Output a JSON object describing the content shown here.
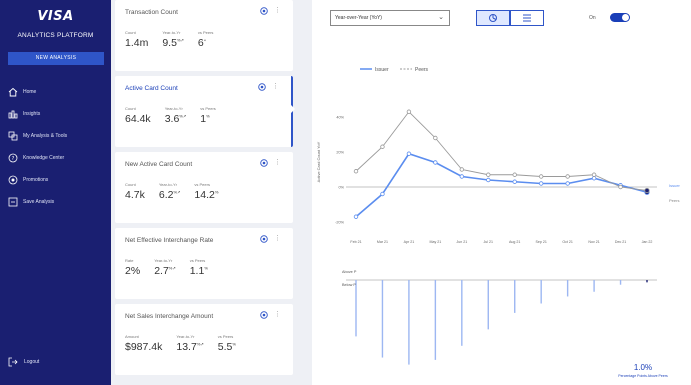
{
  "sidebar": {
    "brand": "VISA",
    "subtitle": "ANALYTICS PLATFORM",
    "new_button": "NEW ANALYSIS",
    "items": [
      {
        "label": "Home"
      },
      {
        "label": "Insights"
      },
      {
        "label": "My Analysis & Tools"
      },
      {
        "label": "Knowledge Center"
      },
      {
        "label": "Promotions"
      },
      {
        "label": "Save Analysis"
      }
    ],
    "signout": "Logout"
  },
  "cards": [
    {
      "title": "Transaction Count",
      "metrics": [
        {
          "label": "Count",
          "value": "1.4m",
          "trend": ""
        },
        {
          "label": "Year-to-Yr",
          "value": "9.5",
          "trend": "%↗"
        },
        {
          "label": "vs Peers",
          "value": "6",
          "trend": "×"
        }
      ]
    },
    {
      "title": "Active Card Count",
      "metrics": [
        {
          "label": "Count",
          "value": "64.4k",
          "trend": ""
        },
        {
          "label": "Year-to-Yr",
          "value": "3.6",
          "trend": "%↗"
        },
        {
          "label": "vs Peers",
          "value": "1",
          "trend": "%"
        }
      ]
    },
    {
      "title": "New Active Card Count",
      "metrics": [
        {
          "label": "Count",
          "value": "4.7k",
          "trend": ""
        },
        {
          "label": "Year-to-Yr",
          "value": "6.2",
          "trend": "%↗"
        },
        {
          "label": "vs Peers",
          "value": "14.2",
          "trend": "%"
        }
      ]
    },
    {
      "title": "Net Effective Interchange Rate",
      "metrics": [
        {
          "label": "Rate",
          "value": "2%",
          "trend": ""
        },
        {
          "label": "Year-to-Yr",
          "value": "2.7",
          "trend": "%↗"
        },
        {
          "label": "vs Peers",
          "value": "1.1",
          "trend": "%"
        }
      ]
    },
    {
      "title": "Net Sales Interchange Amount",
      "metrics": [
        {
          "label": "Amount",
          "value": "$987.4k",
          "trend": ""
        },
        {
          "label": "Year-to-Yr",
          "value": "13.7",
          "trend": "%↗"
        },
        {
          "label": "vs Peers",
          "value": "5.5",
          "trend": "%"
        }
      ]
    }
  ],
  "panel": {
    "dropdown_value": "Year-over-Year (YoY)",
    "switch_label": "On",
    "switch_on": true,
    "end_value": "1.0%",
    "end_caption": "Percentage Points Above Peers",
    "side_label_top": "Issuer",
    "side_label_bottom": "Peers",
    "bar_axis_labels": [
      "Above P",
      "Below P"
    ]
  },
  "colors": {
    "primary": "#1a1f71",
    "accent": "#2f55c8",
    "issuer_line": "#5b8def",
    "peers_line": "#9a9a9a"
  },
  "chart_data": {
    "type": "line",
    "legend": [
      "Issuer",
      "Peers"
    ],
    "ylabel": "Active Card Count YoY",
    "x": [
      "Feb 21",
      "Mar 21",
      "Apr 21",
      "May 21",
      "Jun 21",
      "Jul 21",
      "Aug 21",
      "Sep 21",
      "Oct 21",
      "Nov 21",
      "Dec 21",
      "Jan 22"
    ],
    "ylim": [
      -20,
      60
    ],
    "yticks": [
      "40%",
      "20%",
      "0%",
      "-20%"
    ],
    "series": [
      {
        "name": "Issuer",
        "values": [
          -17,
          -4,
          19,
          14,
          6,
          4,
          3,
          2,
          2,
          5,
          1,
          -3
        ]
      },
      {
        "name": "Peers",
        "values": [
          9,
          23,
          43,
          28,
          10,
          7,
          7,
          6,
          6,
          7,
          0,
          -2
        ]
      }
    ],
    "bars": [
      -24,
      -33,
      -36,
      -34,
      -28,
      -21,
      -14,
      -10,
      -7,
      -5,
      -2,
      -1
    ]
  }
}
